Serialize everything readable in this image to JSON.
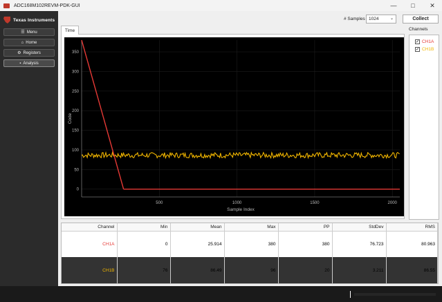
{
  "window": {
    "title": "ADC168M102REVM-PDK-GUI"
  },
  "sidebar": {
    "logo": "Texas Instruments",
    "nav": [
      {
        "label": "Menu",
        "icon": "menu-icon"
      },
      {
        "label": "Home",
        "icon": "home-icon"
      },
      {
        "label": "Registers",
        "icon": "registers-icon"
      },
      {
        "label": "Analysis",
        "icon": "analysis-icon"
      }
    ]
  },
  "toolbar": {
    "samples_label": "# Samples",
    "samples_value": "1024",
    "collect_label": "Collect"
  },
  "tabs": [
    {
      "label": "Time"
    }
  ],
  "channels": {
    "title": "Channels",
    "items": [
      {
        "label": "CH1A",
        "checked": true,
        "color": "#e53935"
      },
      {
        "label": "CH1B",
        "checked": true,
        "color": "#f2b600"
      }
    ]
  },
  "chart_data": {
    "type": "scatter",
    "xlabel": "Sample Index",
    "ylabel": "Code",
    "xlim": [
      0,
      2048
    ],
    "ylim": [
      -20,
      380
    ],
    "xticks": [
      500,
      1000,
      1500,
      2000
    ],
    "yticks": [
      0,
      50,
      100,
      150,
      200,
      250,
      300,
      350
    ],
    "series": [
      {
        "name": "CH1A",
        "color": "#e53935",
        "segments": [
          {
            "x0": 0,
            "x1": 270,
            "y0": 380,
            "y1": 0
          },
          {
            "x0": 270,
            "x1": 2048,
            "y0": 0,
            "y1": 0
          }
        ]
      },
      {
        "name": "CH1B",
        "color": "#f2b600",
        "mean": 86.49,
        "min": 76,
        "max": 96
      }
    ]
  },
  "stats": {
    "headers": [
      "Channel",
      "Min",
      "Mean",
      "Max",
      "PP",
      "StdDev",
      "RMS"
    ],
    "rows": [
      [
        "CH1A",
        "0",
        "25.914",
        "380",
        "380",
        "76.723",
        "80.963"
      ],
      [
        "CH1B",
        "76",
        "86.49",
        "96",
        "20",
        "3.211",
        "86.55"
      ]
    ]
  }
}
